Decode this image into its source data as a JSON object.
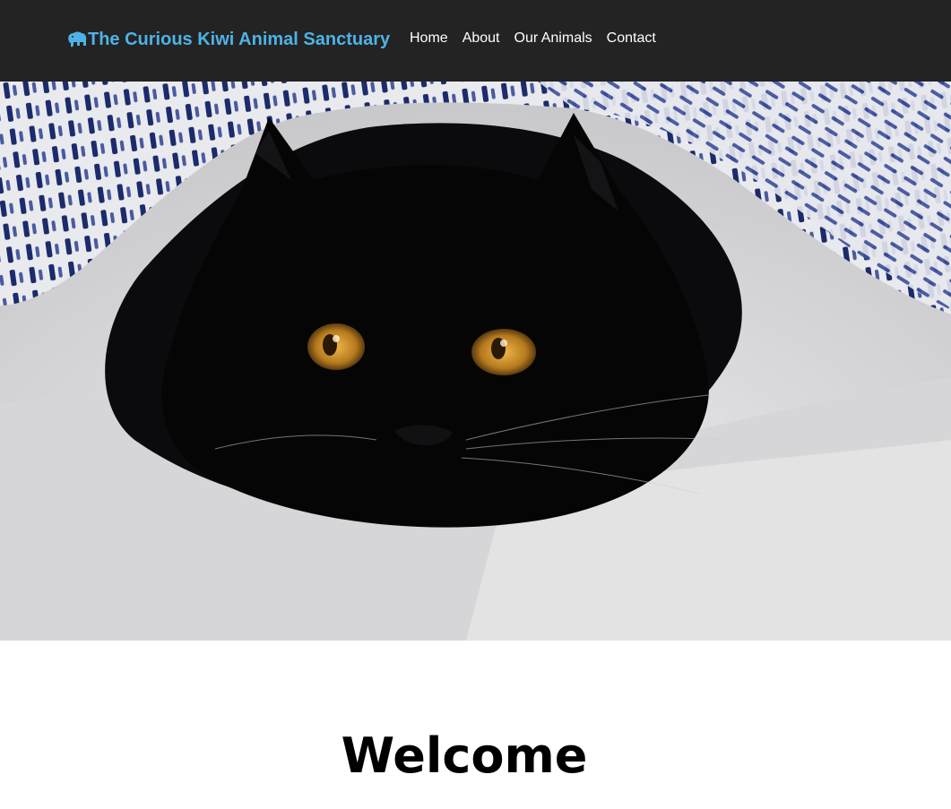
{
  "header": {
    "brand": {
      "icon": "elephant-icon",
      "title": "The Curious Kiwi Animal Sanctuary",
      "color": "#4db3e6"
    },
    "nav": [
      {
        "label": "Home"
      },
      {
        "label": "About"
      },
      {
        "label": "Our Animals"
      },
      {
        "label": "Contact"
      }
    ],
    "background": "#232323"
  },
  "hero": {
    "image": "black-cat-under-blanket-photo"
  },
  "main": {
    "heading": "Welcome"
  }
}
